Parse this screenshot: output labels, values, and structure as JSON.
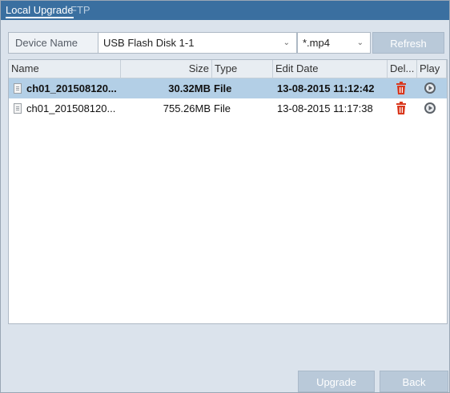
{
  "tabs": [
    {
      "label": "Local Upgrade",
      "active": true
    },
    {
      "label": "FTP",
      "active": false
    }
  ],
  "device": {
    "label": "Device Name",
    "selected": "USB Flash Disk 1-1",
    "extension": "*.mp4",
    "refresh_label": "Refresh"
  },
  "table": {
    "headers": {
      "name": "Name",
      "size": "Size",
      "type": "Type",
      "edit_date": "Edit Date",
      "delete": "Del...",
      "play": "Play"
    },
    "rows": [
      {
        "name": "ch01_201508120...",
        "size": "30.32MB",
        "type": "File",
        "edit_date": "13-08-2015 11:12:42",
        "selected": true
      },
      {
        "name": "ch01_201508120...",
        "size": "755.26MB",
        "type": "File",
        "edit_date": "13-08-2015 11:17:38",
        "selected": false
      }
    ]
  },
  "buttons": {
    "upgrade": "Upgrade",
    "back": "Back"
  },
  "icons": {
    "file": "file-icon",
    "delete": "trash-icon",
    "play": "play-icon"
  },
  "colors": {
    "tabbar": "#3a6fa0",
    "selected_row": "#b3cfe6",
    "delete_icon": "#d9381e",
    "button": "#b9c9d9"
  }
}
